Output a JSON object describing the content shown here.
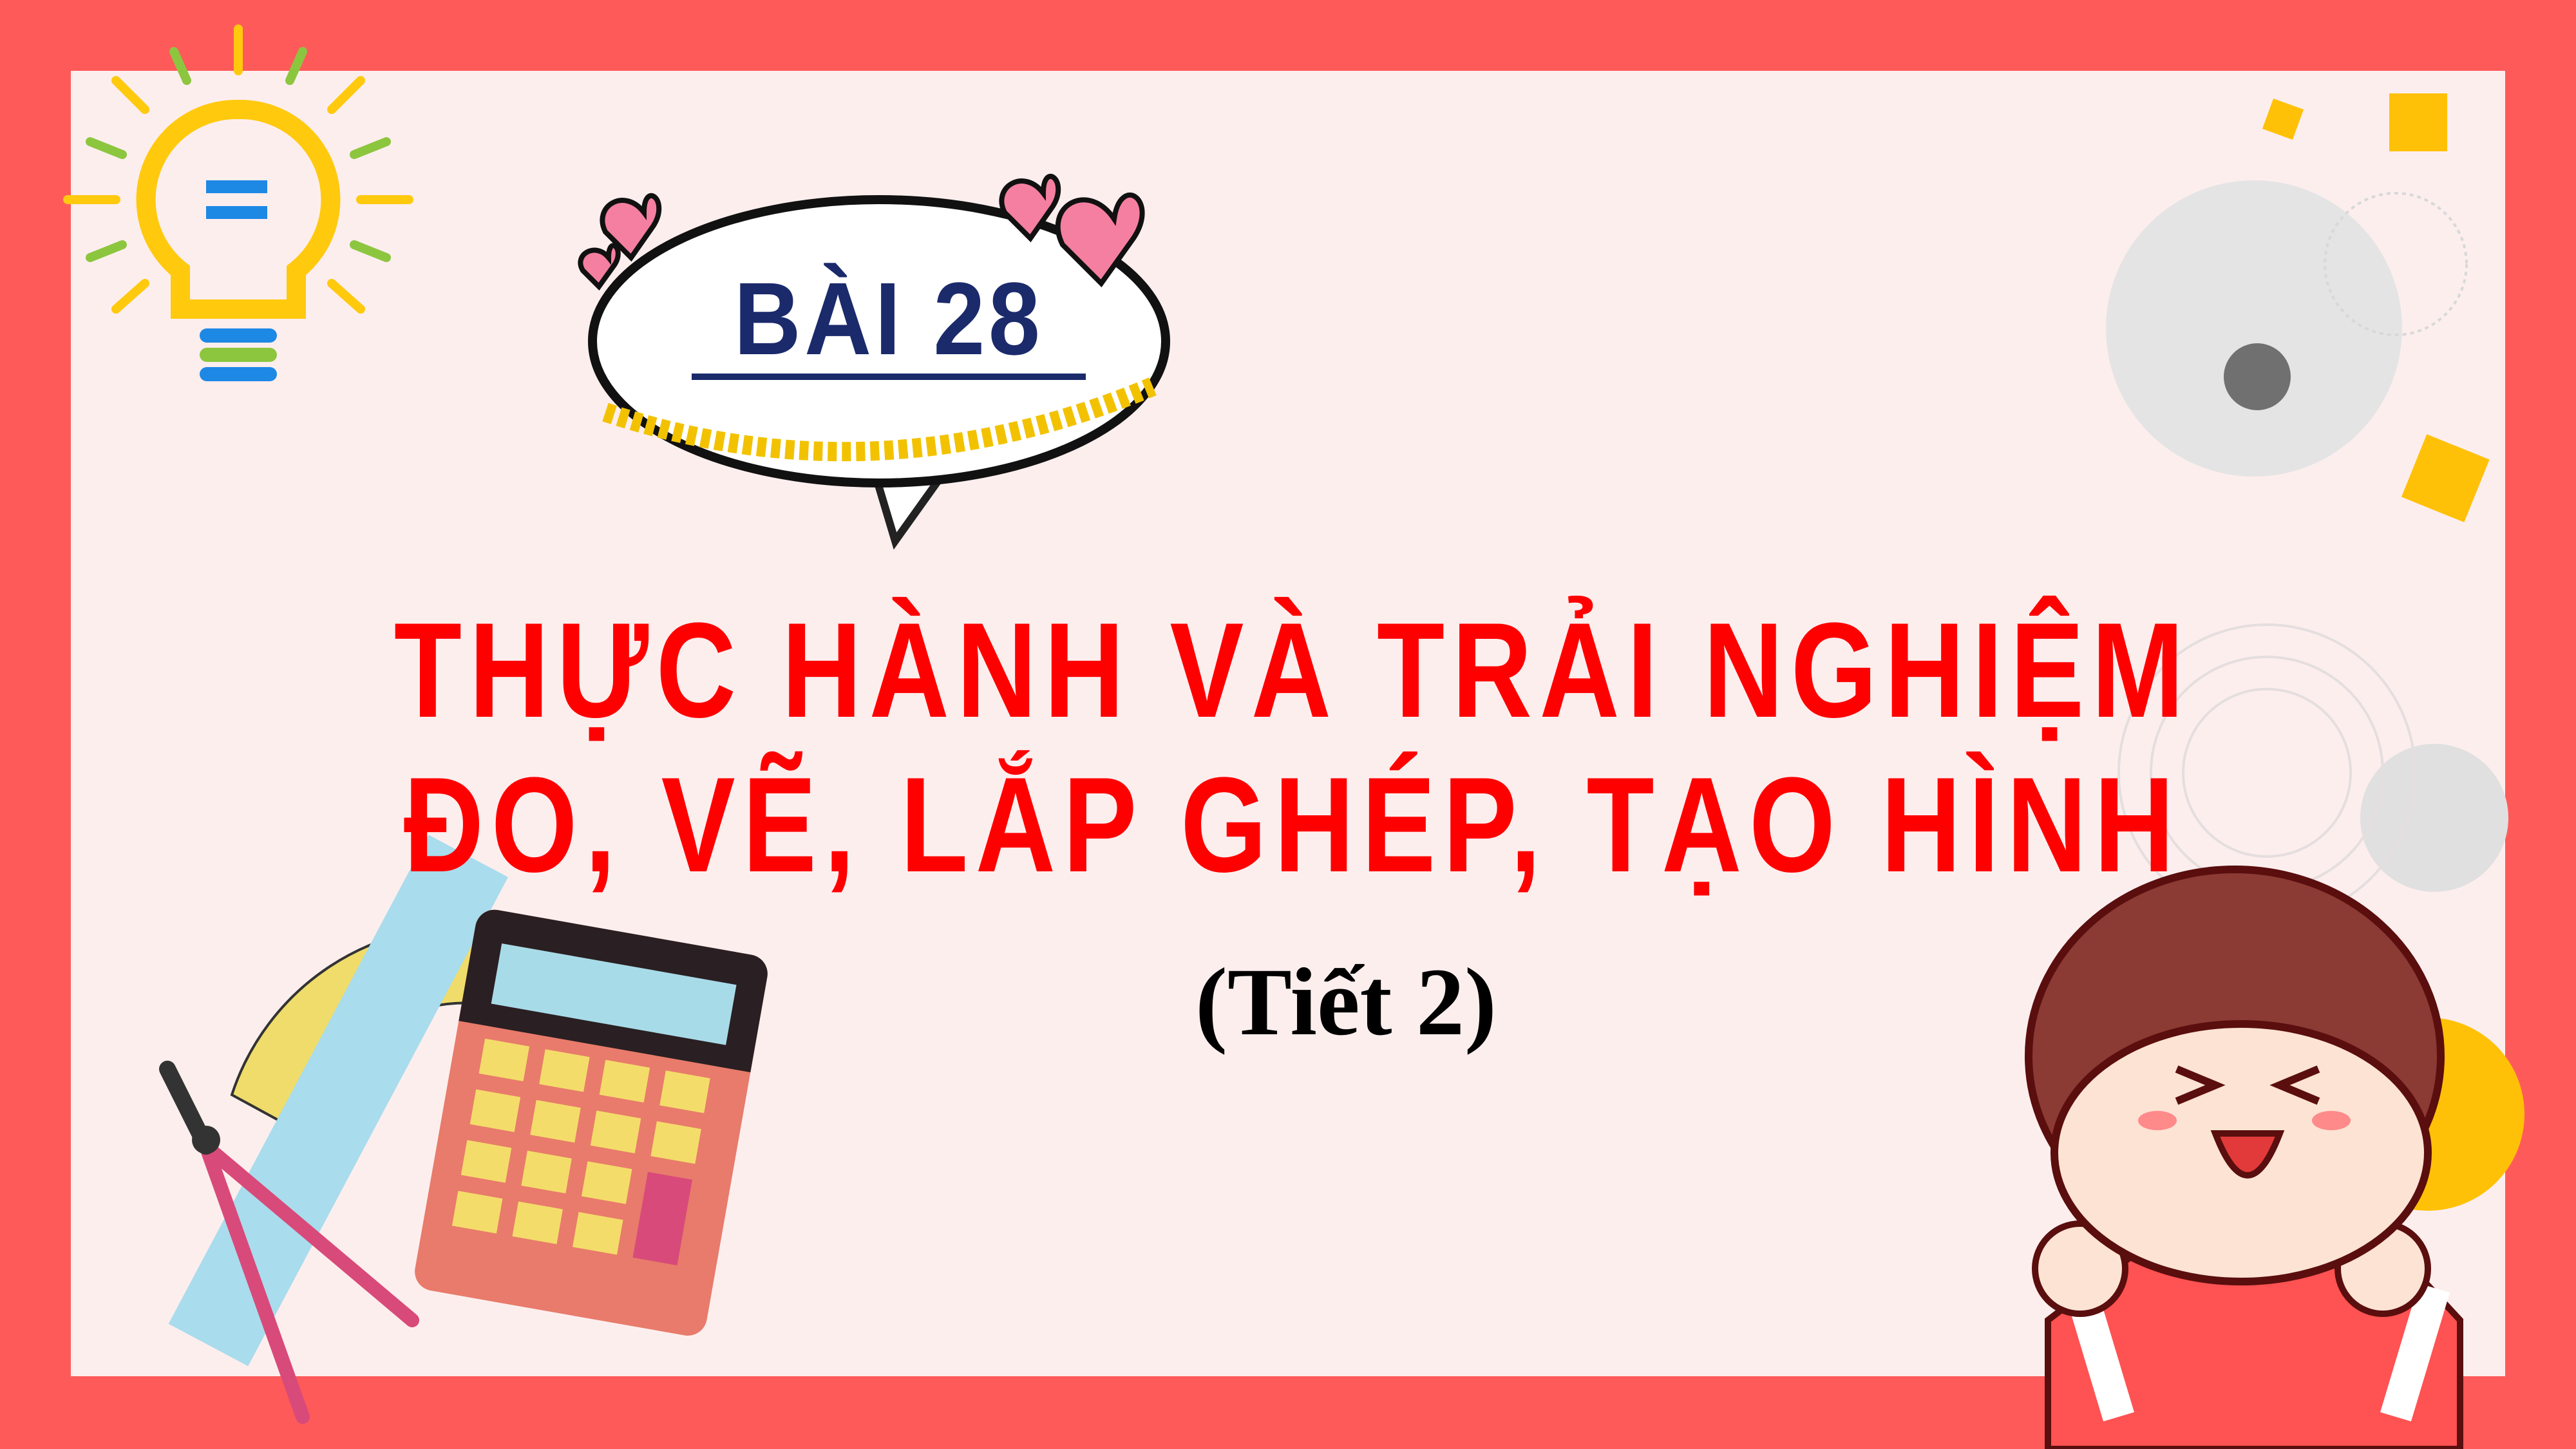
{
  "slide": {
    "lesson_label": "BÀI 28",
    "title_line1": "THỰC HÀNH VÀ TRẢI NGHIỆM",
    "title_line2": "ĐO, VẼ, LẮP GHÉP, TẠO HÌNH",
    "period": "(Tiết 2)"
  },
  "colors": {
    "border": "#ff5a5a",
    "background": "#fdeeee",
    "title": "#ff0000",
    "lesson": "#1b2a6b",
    "accent_yellow": "#ffc107"
  },
  "icons": [
    "lightbulb-icon",
    "speech-bubble-icon",
    "heart-icon",
    "calculator-icon",
    "ruler-icon",
    "protractor-icon",
    "compass-icon",
    "cheering-boy-illustration"
  ]
}
